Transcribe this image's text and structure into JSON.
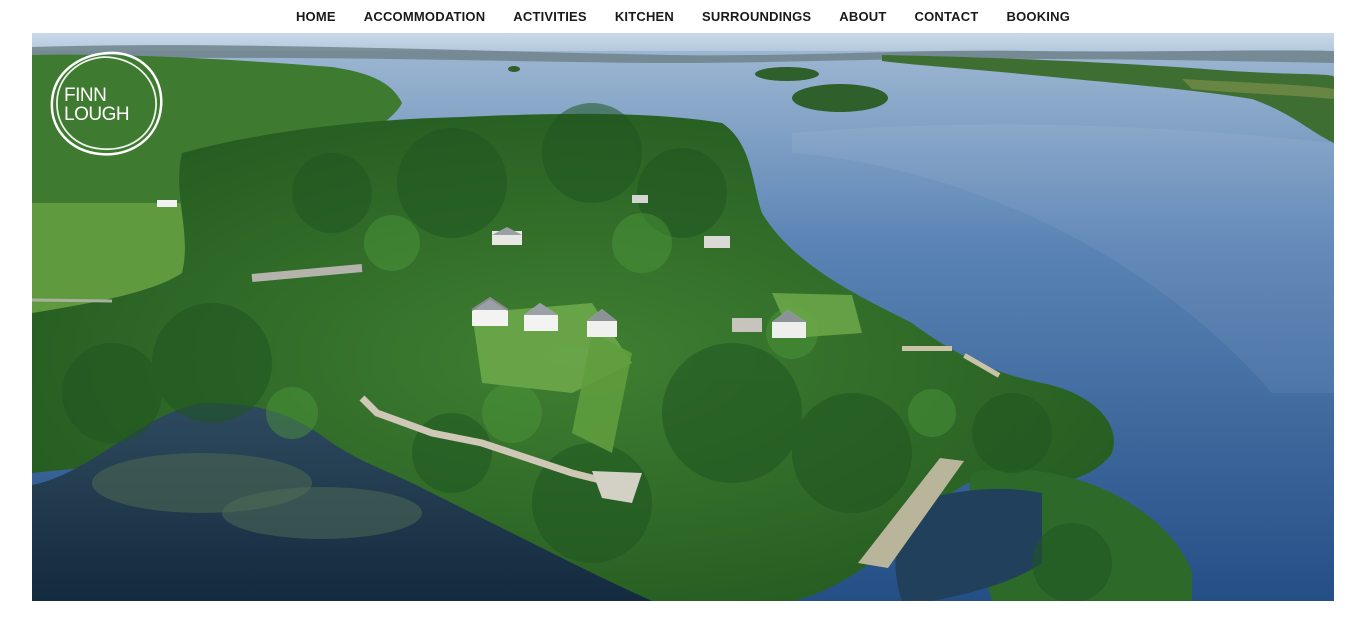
{
  "nav": {
    "items": [
      {
        "label": "HOME"
      },
      {
        "label": "ACCOMMODATION"
      },
      {
        "label": "ACTIVITIES"
      },
      {
        "label": "KITCHEN"
      },
      {
        "label": "SURROUNDINGS"
      },
      {
        "label": "ABOUT"
      },
      {
        "label": "CONTACT"
      },
      {
        "label": "BOOKING"
      }
    ]
  },
  "logo": {
    "line1": "FINN",
    "line2": "LOUGH"
  },
  "colors": {
    "nav_text": "#1a1a1a",
    "water": "#3f6a9e",
    "forest": "#2f6b2a",
    "background": "#ffffff"
  }
}
